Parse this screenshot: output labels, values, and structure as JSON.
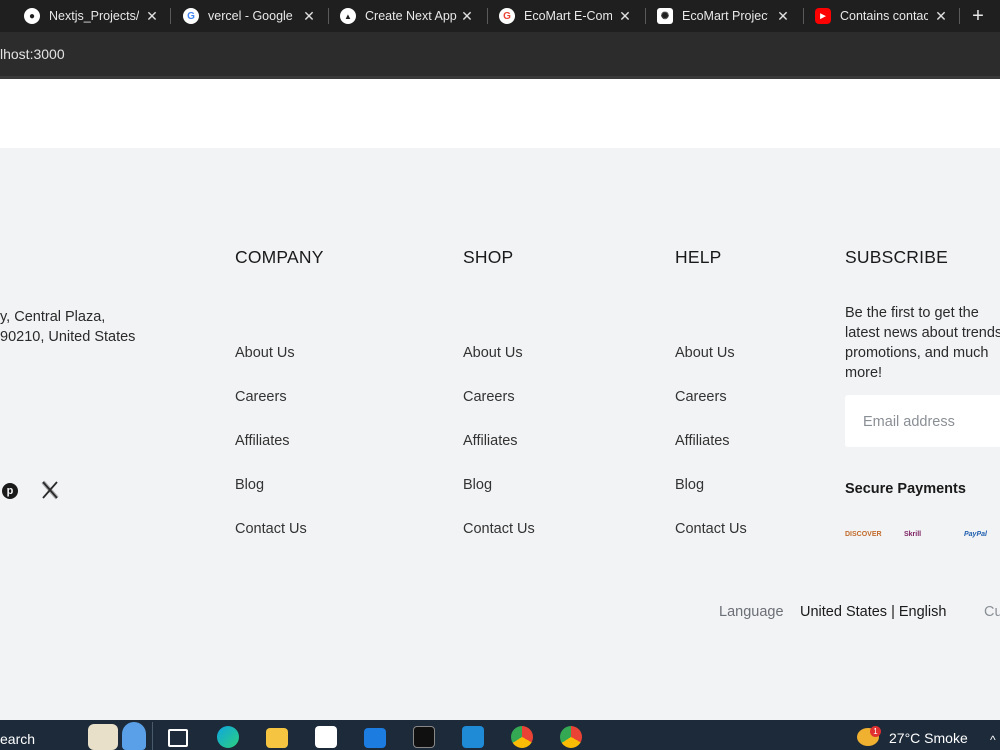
{
  "browser": {
    "tabs": [
      {
        "label": "Nextjs_Projects/",
        "icon": "github-icon",
        "color": "#ffffff"
      },
      {
        "label": "vercel - Google",
        "icon": "google-icon",
        "color": "#ffffff"
      },
      {
        "label": "Create Next App",
        "icon": "vercel-icon",
        "color": "#ffffff"
      },
      {
        "label": "EcoMart E-Comm",
        "icon": "google-icon",
        "color": "#ffffff"
      },
      {
        "label": "EcoMart Project",
        "icon": "openai-icon",
        "color": "#ffffff"
      },
      {
        "label": "Contains contact",
        "icon": "youtube-icon",
        "color": "#ff0000"
      }
    ],
    "close_glyph": "✕",
    "new_tab_glyph": "+",
    "address": "lhost:3000"
  },
  "footer": {
    "address_lines": [
      "y, Central Plaza,",
      "90210, United States"
    ],
    "columns": [
      {
        "title": "COMPANY",
        "links": [
          "About Us",
          "Careers",
          "Affiliates",
          "Blog",
          "Contact Us"
        ]
      },
      {
        "title": "SHOP",
        "links": [
          "About Us",
          "Careers",
          "Affiliates",
          "Blog",
          "Contact Us"
        ]
      },
      {
        "title": "HELP",
        "links": [
          "About Us",
          "Careers",
          "Affiliates",
          "Blog",
          "Contact Us"
        ]
      }
    ],
    "subscribe": {
      "title": "SUBSCRIBE",
      "text": "Be the first to get the latest news about trends, promotions, and much more!",
      "email_placeholder": "Email address"
    },
    "secure_payments": {
      "title": "Secure Payments",
      "methods": [
        "DISCOVER",
        "Skrill",
        "PayPal"
      ]
    },
    "language": {
      "label": "Language",
      "value": "United States | English",
      "next": "Cu"
    }
  },
  "taskbar": {
    "search_label": "earch",
    "weather": "27°C  Smoke",
    "notification_count": "1"
  },
  "colors": {
    "footer_bg": "#f2f3f5",
    "tabbar_bg": "#1f1f1f",
    "taskbar_bg": "#1c2a3a"
  }
}
